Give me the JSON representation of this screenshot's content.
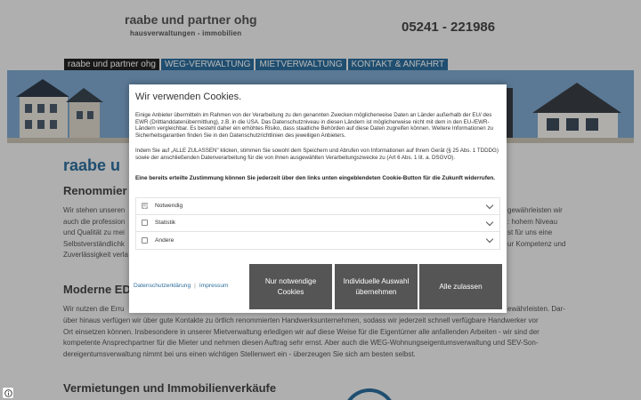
{
  "header": {
    "brand_title": "raabe und partner ohg",
    "brand_subtitle": "hausverwaltungen - immobilien",
    "phone": "05241 - 221986"
  },
  "nav": {
    "items": [
      {
        "label": "raabe und partner ohg",
        "active": true
      },
      {
        "label": "WEG-VERWALTUNG",
        "active": false
      },
      {
        "label": "MIETVERWALTUNG",
        "active": false
      },
      {
        "label": "KONTAKT & ANFAHRT",
        "active": false
      }
    ]
  },
  "content": {
    "heading_main": "raabe u",
    "section1_heading": "Renommier",
    "section1_lines": [
      "Wir stehen unseren",
      "auch die profession",
      "und Qualität zu mei",
      "Selbstverständlichk",
      "Zuverlässigkeit verla"
    ],
    "section1_right_lines": [
      "gewährleisten wir",
      ": hohem Niveau",
      "st für uns eine",
      "ur Kompetenz und"
    ],
    "section2_heading": "Moderne ED",
    "section2_first_line_left": "Wir nutzen die Erru",
    "section2_first_line_right": "ewährleisten. Dar-",
    "section2_lines": [
      "über hinaus verfügen wir über gute Kontakte zu örtlich renommierten Handwerksunternehmen, sodass wir jederzeit schnell verfügbare Handwerker vor",
      "Ort einsetzen können. Insbesondere in unserer Mietverwaltung erledigen wir auf diese Weise für die Eigentümer alle anfallenden Arbeiten - wir sind der",
      "kompetente Ansprechpartner für die Mieter und nehmen diesen Auftrag sehr ernst. Aber auch die WEG-Wohnungseigentumsverwaltung und SEV-Son-",
      "dereigentumsverwaltung nimmt bei uns einen wichtigen Stellenwert ein - überzeugen Sie sich am besten selbst."
    ],
    "section3_heading": "Vermietungen und Immobilienverkäufe"
  },
  "cookie": {
    "title": "Wir verwenden Cookies.",
    "paragraph1": "Einige Anbieter übermitteln im Rahmen von der Verarbeitung zu den genannten Zwecken möglicherweise Daten an Länder außerhalb der EU/ des EWR (Drittlanddatenübermittlung), z.B. in die USA. Das Datenschutzniveau in diesen Ländern ist möglicherweise nicht mit dem in den EU-/EWR-Ländern vergleichbar. Es besteht daher ein erhöhtes Risiko, dass staatliche Behörden auf diese Daten zugreifen können. Weitere Informationen zu Sicherheitsgarantien finden Sie in den Datenschutzrichtlinien des jeweiligen Anbieters.",
    "paragraph2": "Indem Sie auf „ALLE ZULASSEN\" klicken, stimmen Sie sowohl dem Speichern und Abrufen von Informationen auf Ihrem Gerät (§ 25 Abs. 1 TDDDG) sowie der anschließenden Datenverarbeitung für die von ihnen ausgewählten Verarbeitungszwecke zu (Art 6 Abs. 1 lit. a. DSGVO).",
    "bold_note": "Eine bereits erteilte Zustimmung können Sie jederzeit über den links unten eingeblendeten Cookie-Button für die Zukunft widerrufen.",
    "categories": [
      {
        "label": "Notwendig",
        "checked": true
      },
      {
        "label": "Statistik",
        "checked": false
      },
      {
        "label": "Andere",
        "checked": false
      }
    ],
    "link_privacy": "Datenschutzerklärung",
    "link_separator": "|",
    "link_imprint": "Impressum",
    "btn_necessary": "Nur notwendige Cookies",
    "btn_individual": "Individuelle Auswahl übernehmen",
    "btn_all": "Alle zulassen"
  },
  "colors": {
    "accent": "#2b6d9b",
    "button": "#555555",
    "nav_active": "#222222"
  },
  "icons": {
    "corner_button": "cookie-settings-icon"
  }
}
